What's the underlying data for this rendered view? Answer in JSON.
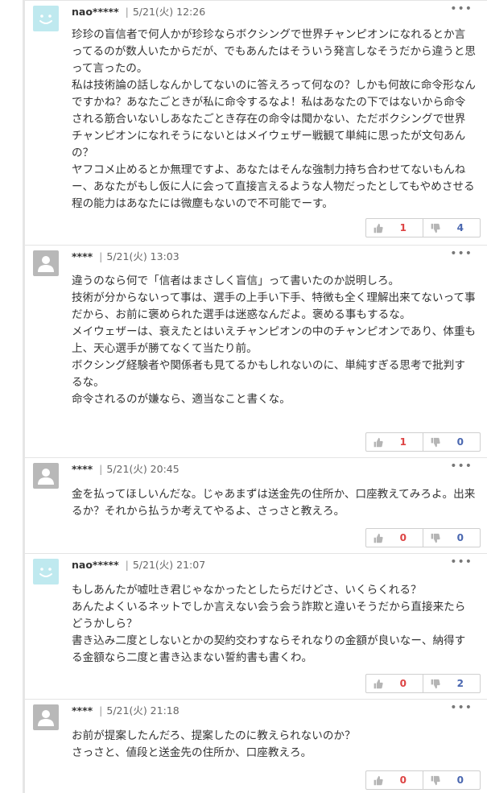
{
  "comments": [
    {
      "avatar": "smiley-avatar",
      "user": "nao*****",
      "date": "5/21(火) 12:26",
      "more": "•••",
      "lines": [
        "珍珍の盲信者で何人かが珍珍ならボクシングで世界チャンピオンになれるとか言ってるのが数人いたからだが、でもあんたはそういう発言しなそうだから違うと思って言ったの。",
        "私は技術論の話しなんかしてないのに答えろって何なの？しかも何故に命令形なんですかね？あなたごときが私に命令するなよ！私はあなたの下ではないから命令される筋合いないしあなたごとき存在の命令は聞かない、ただボクシングで世界チャンピオンになれそうにないとはメイウェザー戦観て単純に思ったが文句あんの？",
        "ヤフコメ止めるとか無理ですよ、あなたはそんな強制力持ち合わせてないもんねー、あなたがもし仮に人に会って直接言えるような人物だったとしてもやめさせる程の能力はあなたには微塵もないので不可能でーす。"
      ],
      "likes": "1",
      "dislikes": "4"
    },
    {
      "avatar": "default-avatar",
      "user": "****",
      "date": "5/21(火) 13:03",
      "more": "•••",
      "lines": [
        "違うのなら何で「信者はまさしく盲信」って書いたのか説明しろ。",
        "技術が分からないって事は、選手の上手い下手、特徴も全く理解出来てないって事だから、お前に褒められた選手は迷惑なんだよ。褒める事もするな。",
        "メイウェザーは、衰えたとはいえチャンピオンの中のチャンピオンであり、体重も上、天心選手が勝てなくて当たり前。",
        "ボクシング経験者や関係者も見てるかもしれないのに、単純すぎる思考で批判するな。",
        "命令されるのが嫌なら、適当なこと書くな。"
      ],
      "likes": "1",
      "dislikes": "0"
    },
    {
      "avatar": "default-avatar",
      "user": "****",
      "date": "5/21(火) 20:45",
      "more": "•••",
      "lines": [
        "金を払ってほしいんだな。じゃあまずは送金先の住所か、口座教えてみろよ。出来るか？それから払うか考えてやるよ、さっさと教えろ。"
      ],
      "likes": "0",
      "dislikes": "0"
    },
    {
      "avatar": "smiley-avatar",
      "user": "nao*****",
      "date": "5/21(火) 21:07",
      "more": "•••",
      "lines": [
        "もしあんたが嘘吐き君じゃなかったとしたらだけどさ、いくらくれる？",
        "あんたよくいるネットでしか言えない会う会う詐欺と違いそうだから直接来たらどうかしら？",
        "書き込み二度としないとかの契約交わすならそれなりの金額が良いなー、納得する金額なら二度と書き込まない誓約書も書くわ。"
      ],
      "likes": "0",
      "dislikes": "2"
    },
    {
      "avatar": "default-avatar",
      "user": "****",
      "date": "5/21(火) 21:18",
      "more": "•••",
      "lines": [
        "お前が提案したんだろ、提案したのに教えられないのか？",
        "さっさと、値段と送金先の住所か、口座教えろ。"
      ],
      "likes": "0",
      "dislikes": "0"
    }
  ]
}
